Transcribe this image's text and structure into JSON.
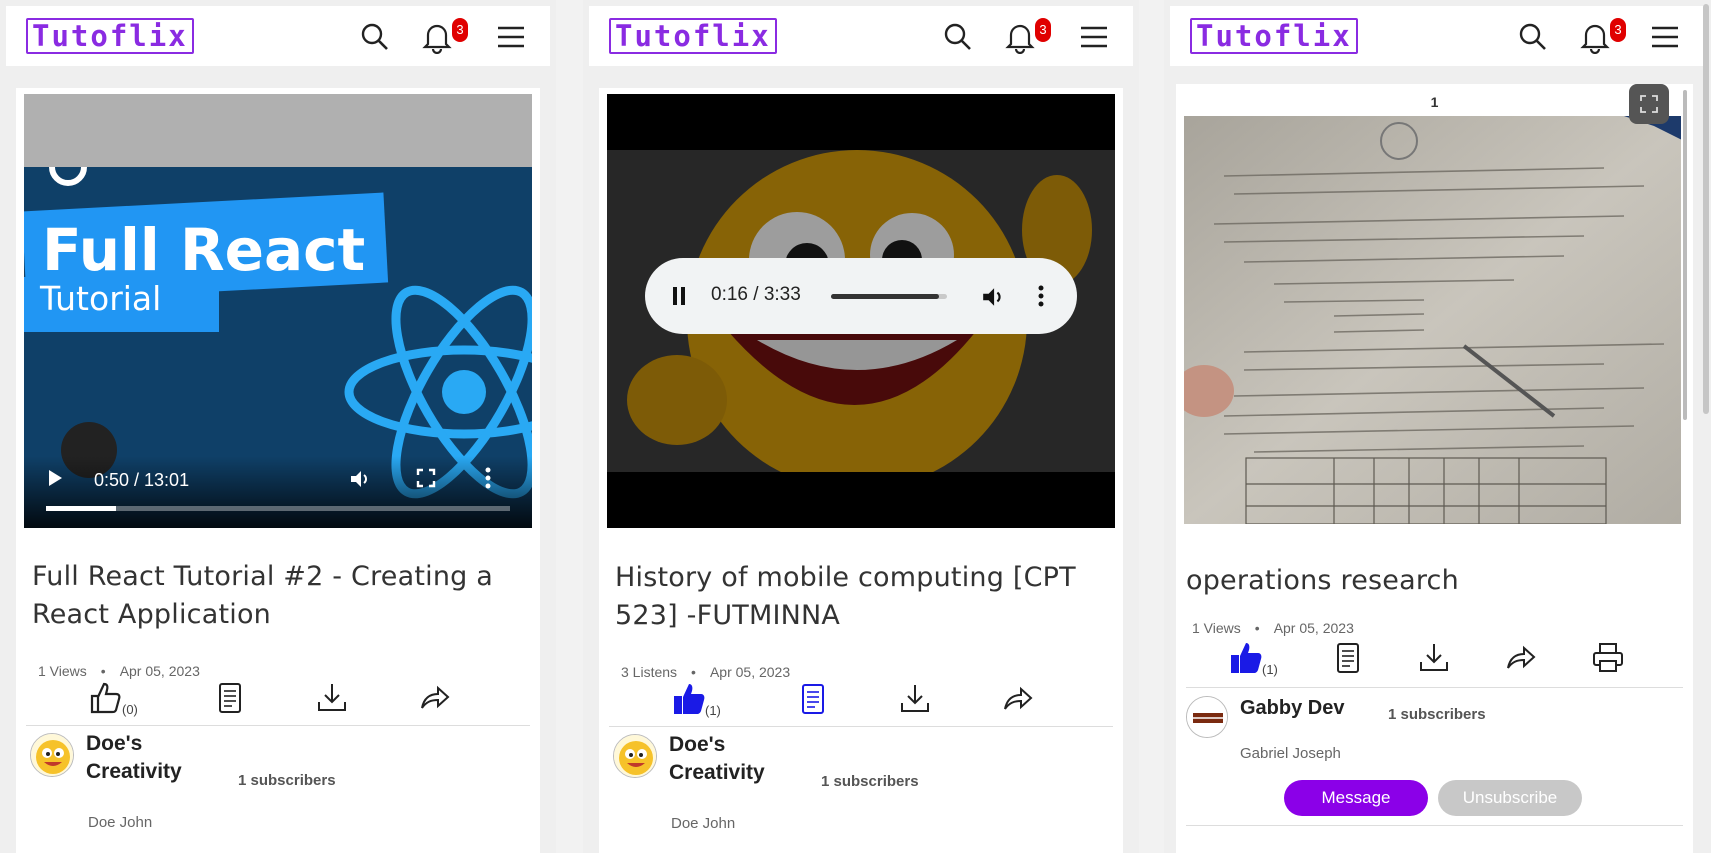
{
  "app": {
    "logo": "Tutoflix",
    "notification_count": "3"
  },
  "colors": {
    "brand": "#8a2be2",
    "like_active": "#1a1ae6",
    "badge": "#e00000",
    "message_button": "#8b00e8"
  },
  "panels": [
    {
      "media": {
        "kind": "video",
        "thumb_headline": "Full React",
        "thumb_subline": "Tutorial",
        "time": "0:50 / 13:01",
        "progress": 0.15
      },
      "title": "Full React Tutorial #2 - Creating a React Application",
      "views": "1 Views",
      "date": "Apr 05, 2023",
      "like_count": "(0)",
      "channel": {
        "name_line1": "Doe's",
        "name_line2": "Creativity",
        "subscribers": "1 subscribers",
        "owner": "Doe John"
      }
    },
    {
      "media": {
        "kind": "audio",
        "time": "0:16 / 3:33",
        "progress": 0.93
      },
      "title": "History of mobile computing [CPT 523] -FUTMINNA",
      "views": "3 Listens",
      "date": "Apr 05, 2023",
      "like_count": "(1)",
      "channel": {
        "name_line1": "Doe's",
        "name_line2": "Creativity",
        "subscribers": "1 subscribers",
        "owner": "Doe John"
      }
    },
    {
      "media": {
        "kind": "document",
        "page_number": "1"
      },
      "title": "operations research",
      "views": "1 Views",
      "date": "Apr 05, 2023",
      "like_count": "(1)",
      "channel": {
        "name_line1": "Gabby Dev",
        "subscribers": "1 subscribers",
        "owner": "Gabriel Joseph"
      },
      "buttons": {
        "message": "Message",
        "unsubscribe": "Unsubscribe"
      }
    }
  ]
}
